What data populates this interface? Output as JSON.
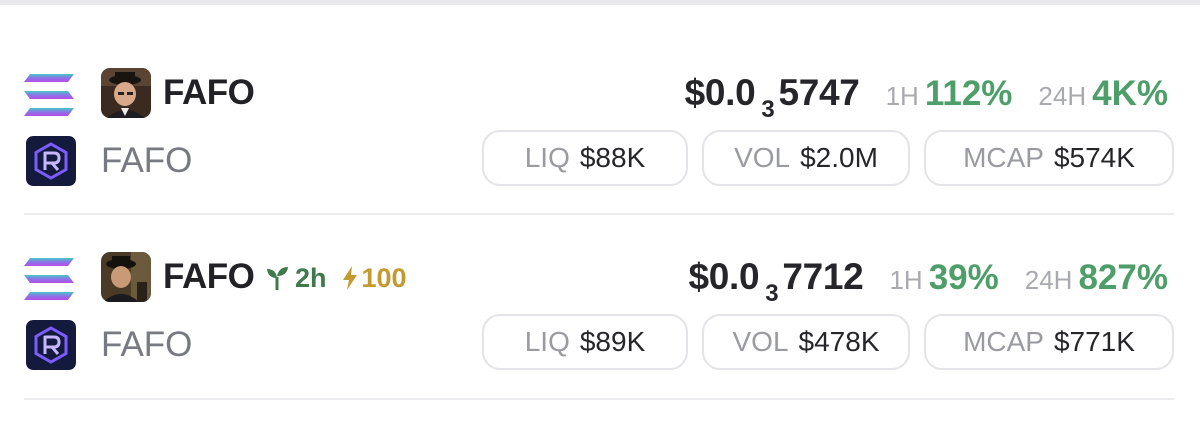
{
  "tokens": [
    {
      "symbol": "FAFO",
      "name": "FAFO",
      "price_prefix": "$0.0",
      "price_zeros": "3",
      "price_digits": "5747",
      "change_1h_label": "1H",
      "change_1h": "112%",
      "change_24h_label": "24H",
      "change_24h": "4K%",
      "liq_label": "LIQ",
      "liq": "$88K",
      "vol_label": "VOL",
      "vol": "$2.0M",
      "mcap_label": "MCAP",
      "mcap": "$574K"
    },
    {
      "symbol": "FAFO",
      "name": "FAFO",
      "age": "2h",
      "boost": "100",
      "price_prefix": "$0.0",
      "price_zeros": "3",
      "price_digits": "7712",
      "change_1h_label": "1H",
      "change_1h": "39%",
      "change_24h_label": "24H",
      "change_24h": "827%",
      "liq_label": "LIQ",
      "liq": "$89K",
      "vol_label": "VOL",
      "vol": "$478K",
      "mcap_label": "MCAP",
      "mcap": "$771K"
    }
  ],
  "colors": {
    "positive": "#4e9e69",
    "age_tag": "#3f7a4f",
    "boost_tag": "#c29a2f",
    "muted": "#a9aab0",
    "dex_bg": "#141a3c",
    "dex_accent": "#7b5cff"
  },
  "icons": {
    "chain": "solana-icon",
    "dex": "raydium-icon",
    "age": "sprout-icon",
    "boost": "lightning-icon"
  }
}
